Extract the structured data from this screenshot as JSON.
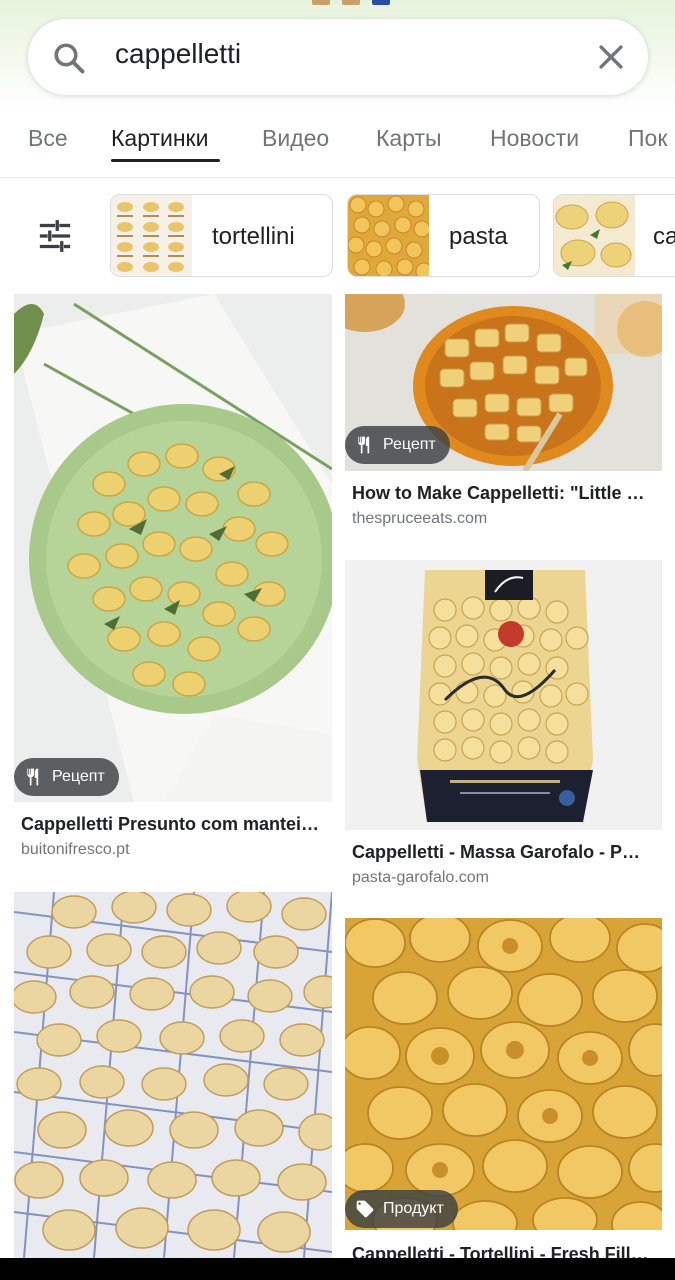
{
  "search": {
    "query": "cappelletti"
  },
  "tabs": [
    {
      "label": "Все"
    },
    {
      "label": "Картинки"
    },
    {
      "label": "Видео"
    },
    {
      "label": "Карты"
    },
    {
      "label": "Новости"
    },
    {
      "label": "Пок"
    }
  ],
  "chips": [
    {
      "label": "tortellini"
    },
    {
      "label": "pasta"
    },
    {
      "label": "ca"
    }
  ],
  "results": [
    {
      "title": "Cappelletti Presunto com mantei…",
      "source": "buitonifresco.pt",
      "badge": "Рецепт"
    },
    {
      "title": "How to Make Cappelletti: \"Little …",
      "source": "thespruceeats.com",
      "badge": "Рецепт"
    },
    {
      "title": "Cappelletti - Massa Garofalo - P…",
      "source": "pasta-garofalo.com",
      "badge": ""
    },
    {
      "title": "",
      "source": "",
      "badge": ""
    },
    {
      "title": "Cappelletti - Tortellini - Fresh Fill…",
      "source": "",
      "badge": "Продукт"
    }
  ],
  "colors": {
    "accent_green": "#e6f3dc",
    "text_primary": "#202124",
    "text_secondary": "#70757a"
  }
}
